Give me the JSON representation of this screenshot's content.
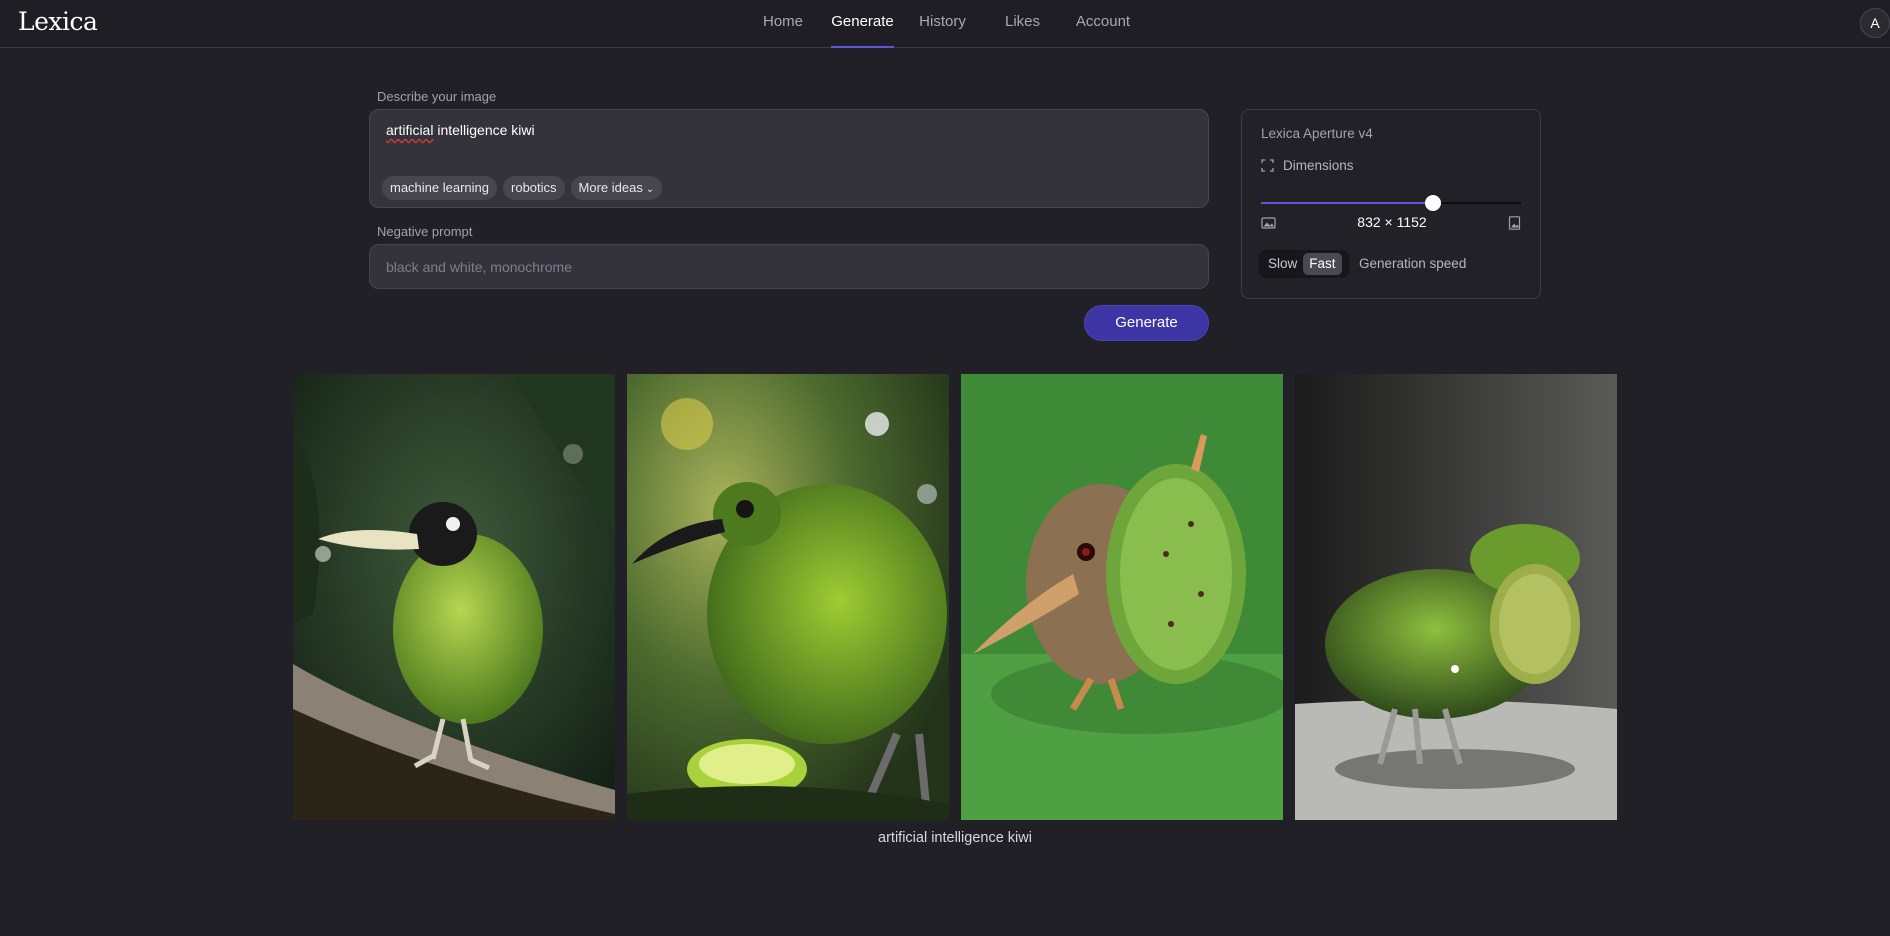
{
  "app": {
    "logo": "Lexica",
    "avatar_initial": "A"
  },
  "nav": {
    "items": [
      {
        "label": "Home",
        "active": false
      },
      {
        "label": "Generate",
        "active": true
      },
      {
        "label": "History",
        "active": false
      },
      {
        "label": "Likes",
        "active": false
      },
      {
        "label": "Account",
        "active": false
      }
    ]
  },
  "prompt": {
    "label": "Describe your image",
    "value_misspelled": "artificial",
    "value_rest": " intelligence kiwi",
    "suggestions": [
      "machine learning",
      "robotics"
    ],
    "more_ideas": "More ideas"
  },
  "negative_prompt": {
    "label": "Negative prompt",
    "placeholder": "black and white, monochrome"
  },
  "generate_button": "Generate",
  "settings": {
    "model": "Lexica Aperture v4",
    "dimensions_label": "Dimensions",
    "dimensions_value": "832 × 1152",
    "slider_fraction": 0.66,
    "speed_options": [
      "Slow",
      "Fast"
    ],
    "speed_selected": "Fast",
    "speed_label": "Generation speed"
  },
  "gallery": {
    "caption": "artificial intelligence kiwi",
    "images": [
      {
        "alt": "green kiwi bird on branch"
      },
      {
        "alt": "fuzzy green kiwi bird with kiwi fruit"
      },
      {
        "alt": "brown kiwi bird with fruit body"
      },
      {
        "alt": "robotic mossy kiwi bird"
      }
    ]
  },
  "colors": {
    "accent": "#5c57d8",
    "button": "#3c35a3",
    "background": "#212027"
  }
}
